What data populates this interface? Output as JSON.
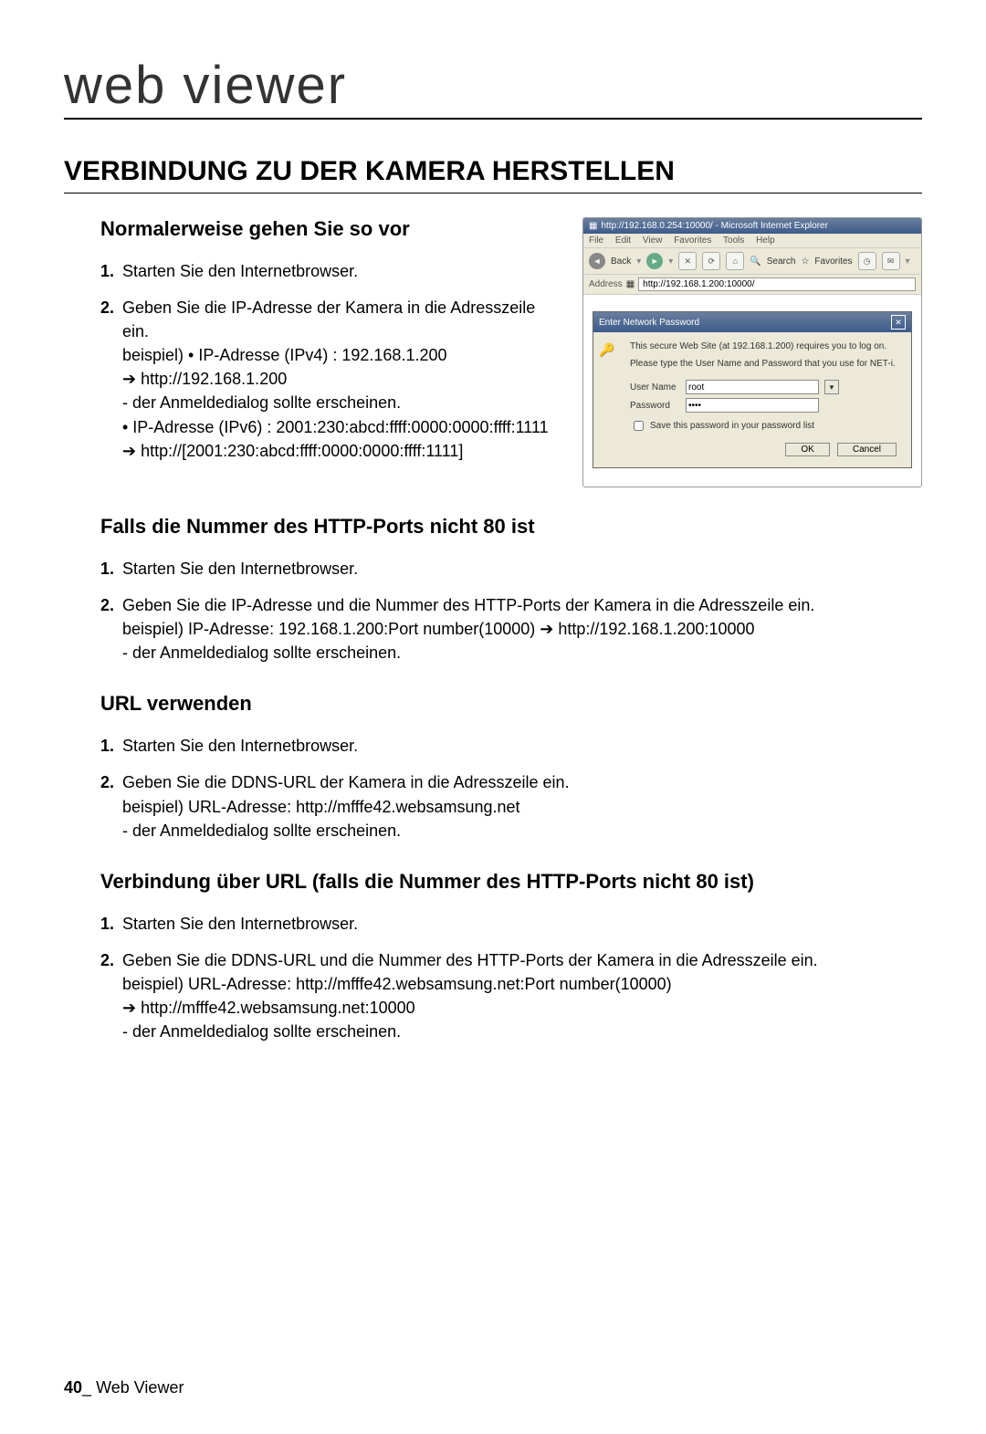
{
  "header": "web viewer",
  "main_title": "VERBINDUNG ZU DER KAMERA HERSTELLEN",
  "section1": {
    "title": "Normalerweise gehen Sie so vor",
    "items": [
      {
        "num": "1.",
        "text": "Starten Sie den Internetbrowser."
      },
      {
        "num": "2.",
        "lines": [
          "Geben Sie die IP-Adresse der Kamera in die Adresszeile ein.",
          "beispiel) • IP-Adresse (IPv4) : 192.168.1.200",
          "➔ http://192.168.1.200",
          "- der Anmeldedialog sollte erscheinen.",
          "• IP-Adresse (IPv6) : 2001:230:abcd:ffff:0000:0000:ffff:1111",
          "➔ http://[2001:230:abcd:ffff:0000:0000:ffff:1111]"
        ]
      }
    ]
  },
  "section2": {
    "title": "Falls die Nummer des HTTP-Ports nicht 80 ist",
    "items": [
      {
        "num": "1.",
        "text": "Starten Sie den Internetbrowser."
      },
      {
        "num": "2.",
        "lines": [
          "Geben Sie die IP-Adresse und die Nummer des HTTP-Ports der Kamera in die Adresszeile ein.",
          "beispiel) IP-Adresse: 192.168.1.200:Port number(10000) ➔ http://192.168.1.200:10000",
          "- der Anmeldedialog sollte erscheinen."
        ]
      }
    ]
  },
  "section3": {
    "title": "URL verwenden",
    "items": [
      {
        "num": "1.",
        "text": "Starten Sie den Internetbrowser."
      },
      {
        "num": "2.",
        "lines": [
          "Geben Sie die DDNS-URL der Kamera in die Adresszeile ein.",
          "beispiel) URL-Adresse: http://mfffe42.websamsung.net",
          "- der Anmeldedialog sollte erscheinen."
        ]
      }
    ]
  },
  "section4": {
    "title": "Verbindung über URL (falls die Nummer des HTTP-Ports nicht 80 ist)",
    "items": [
      {
        "num": "1.",
        "text": "Starten Sie den Internetbrowser."
      },
      {
        "num": "2.",
        "lines": [
          "Geben Sie die DDNS-URL und die Nummer des HTTP-Ports der Kamera in die Adresszeile ein.",
          "beispiel) URL-Adresse: http://mfffe42.websamsung.net:Port number(10000)",
          "➔ http://mfffe42.websamsung.net:10000",
          "- der Anmeldedialog sollte erscheinen."
        ]
      }
    ]
  },
  "ie": {
    "title": "http://192.168.0.254:10000/ - Microsoft Internet Explorer",
    "menu": {
      "file": "File",
      "edit": "Edit",
      "view": "View",
      "fav": "Favorites",
      "tools": "Tools",
      "help": "Help"
    },
    "toolbar": {
      "back": "Back",
      "search": "Search",
      "favorites": "Favorites"
    },
    "addr_label": "Address",
    "addr_value": "http://192.168.1.200:10000/",
    "auth": {
      "title": "Enter Network Password",
      "msg1": "This secure Web Site (at 192.168.1.200) requires you to log on.",
      "msg2": "Please type the User Name and Password that you use for NET-i.",
      "user_label": "User Name",
      "user_value": "root",
      "pass_label": "Password",
      "pass_value": "••••",
      "save_label": "Save this password in your password list",
      "ok": "OK",
      "cancel": "Cancel"
    }
  },
  "footer": {
    "page": "40",
    "sep": "_",
    "label": "Web Viewer"
  }
}
